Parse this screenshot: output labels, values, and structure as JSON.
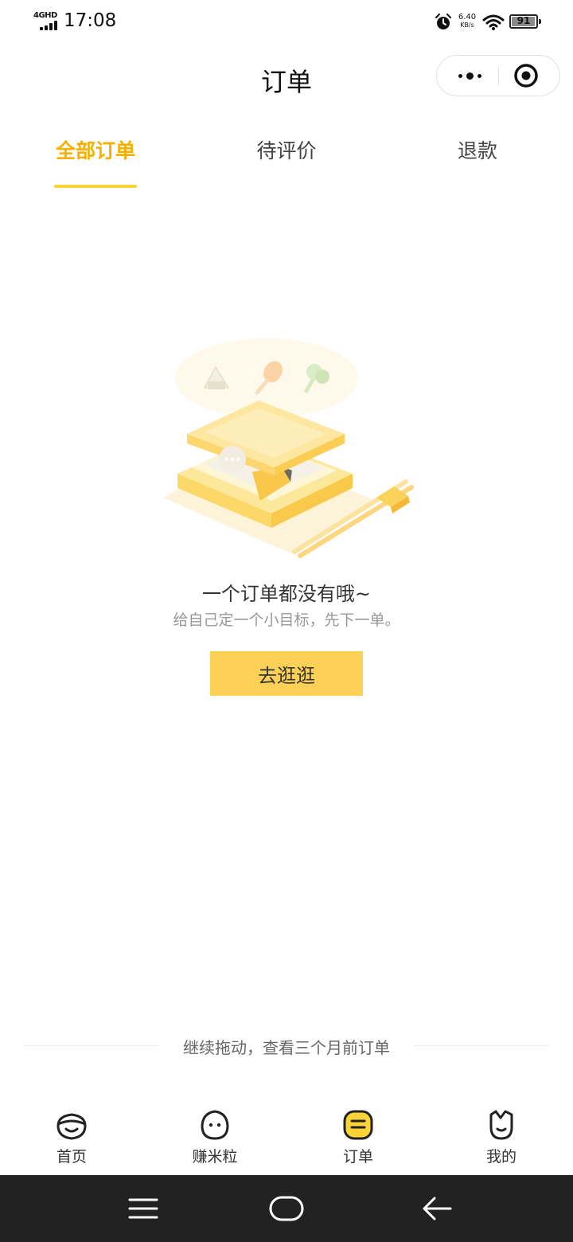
{
  "status_bar": {
    "network": "4GHD",
    "time": "17:08",
    "speed_value": "6.40",
    "speed_unit": "KB/s",
    "battery": "91"
  },
  "header": {
    "title": "订单"
  },
  "tabs": [
    {
      "label": "全部订单",
      "active": true
    },
    {
      "label": "待评价",
      "active": false
    },
    {
      "label": "退款",
      "active": false
    }
  ],
  "empty_state": {
    "title": "一个订单都没有哦~",
    "subtitle": "给自己定一个小目标，先下一单。",
    "button_label": "去逛逛"
  },
  "older_orders_hint": "继续拖动，查看三个月前订单",
  "bottom_nav": [
    {
      "label": "首页",
      "icon": "home-icon",
      "active": false
    },
    {
      "label": "赚米粒",
      "icon": "earn-rice-icon",
      "active": false
    },
    {
      "label": "订单",
      "icon": "order-icon",
      "active": true
    },
    {
      "label": "我的",
      "icon": "profile-icon",
      "active": false
    }
  ],
  "colors": {
    "accent": "#f5b000",
    "button": "#fcd156",
    "active_icon_fill": "#fcd336"
  }
}
